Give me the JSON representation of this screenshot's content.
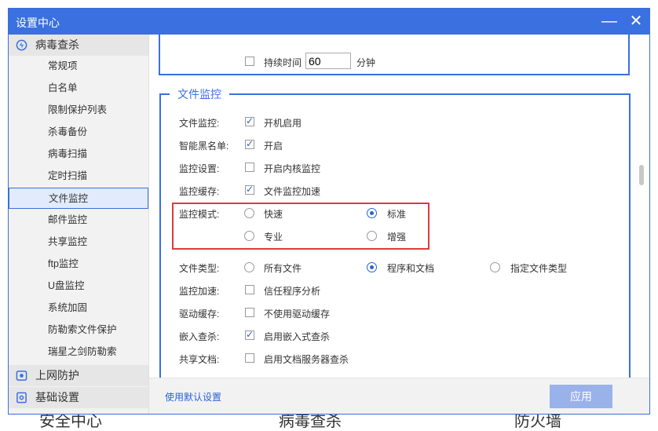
{
  "window": {
    "title": "设置中心",
    "minimize_glyph": "—",
    "close_glyph": "✕"
  },
  "sidebar": {
    "categories": [
      {
        "label": "病毒查杀",
        "icon": "virus-scan-icon"
      },
      {
        "label": "上网防护",
        "icon": "web-protection-icon"
      },
      {
        "label": "基础设置",
        "icon": "basic-settings-icon"
      }
    ],
    "items": [
      {
        "label": "常规项"
      },
      {
        "label": "白名单"
      },
      {
        "label": "限制保护列表"
      },
      {
        "label": "杀毒备份"
      },
      {
        "label": "病毒扫描"
      },
      {
        "label": "定时扫描"
      },
      {
        "label": "文件监控",
        "active": true
      },
      {
        "label": "邮件监控"
      },
      {
        "label": "共享监控"
      },
      {
        "label": "ftp监控"
      },
      {
        "label": "U盘监控"
      },
      {
        "label": "系统加固"
      },
      {
        "label": "防勒索文件保护"
      },
      {
        "label": "瑞星之剑防勒索"
      }
    ]
  },
  "top_section": {
    "duration_label": "持续时间",
    "duration_value": "60",
    "duration_unit": "分钟",
    "checked": false
  },
  "file_monitor": {
    "legend": "文件监控",
    "rows": {
      "monitor": {
        "label": "文件监控:",
        "option": "开机启用",
        "checked": true
      },
      "blacklist": {
        "label": "智能黑名单:",
        "option": "开启",
        "checked": true
      },
      "settings": {
        "label": "监控设置:",
        "option": "开启内核监控",
        "checked": false
      },
      "cache": {
        "label": "监控缓存:",
        "option": "文件监控加速",
        "checked": true
      },
      "mode": {
        "label": "监控模式:",
        "options": [
          "快速",
          "标准",
          "专业",
          "增强"
        ],
        "selected": "标准"
      },
      "filetype": {
        "label": "文件类型:",
        "options": [
          "所有文件",
          "程序和文档",
          "指定文件类型"
        ],
        "selected": "程序和文档"
      },
      "accel": {
        "label": "监控加速:",
        "option": "信任程序分析",
        "checked": false
      },
      "driver": {
        "label": "驱动缓存:",
        "option": "不使用驱动缓存",
        "checked": false
      },
      "embedded": {
        "label": "嵌入查杀:",
        "option": "启用嵌入式查杀",
        "checked": true
      },
      "shared": {
        "label": "共享文档:",
        "option": "启用文档服务器查杀",
        "checked": false
      }
    }
  },
  "footer": {
    "reset_label": "使用默认设置",
    "apply_label": "应用"
  },
  "background": {
    "labels": [
      "安全中心",
      "病毒查杀",
      "防火墙"
    ]
  },
  "colors": {
    "accent": "#3a70e0",
    "highlight": "#e03a3a",
    "apply_disabled": "#9ab2ea"
  }
}
